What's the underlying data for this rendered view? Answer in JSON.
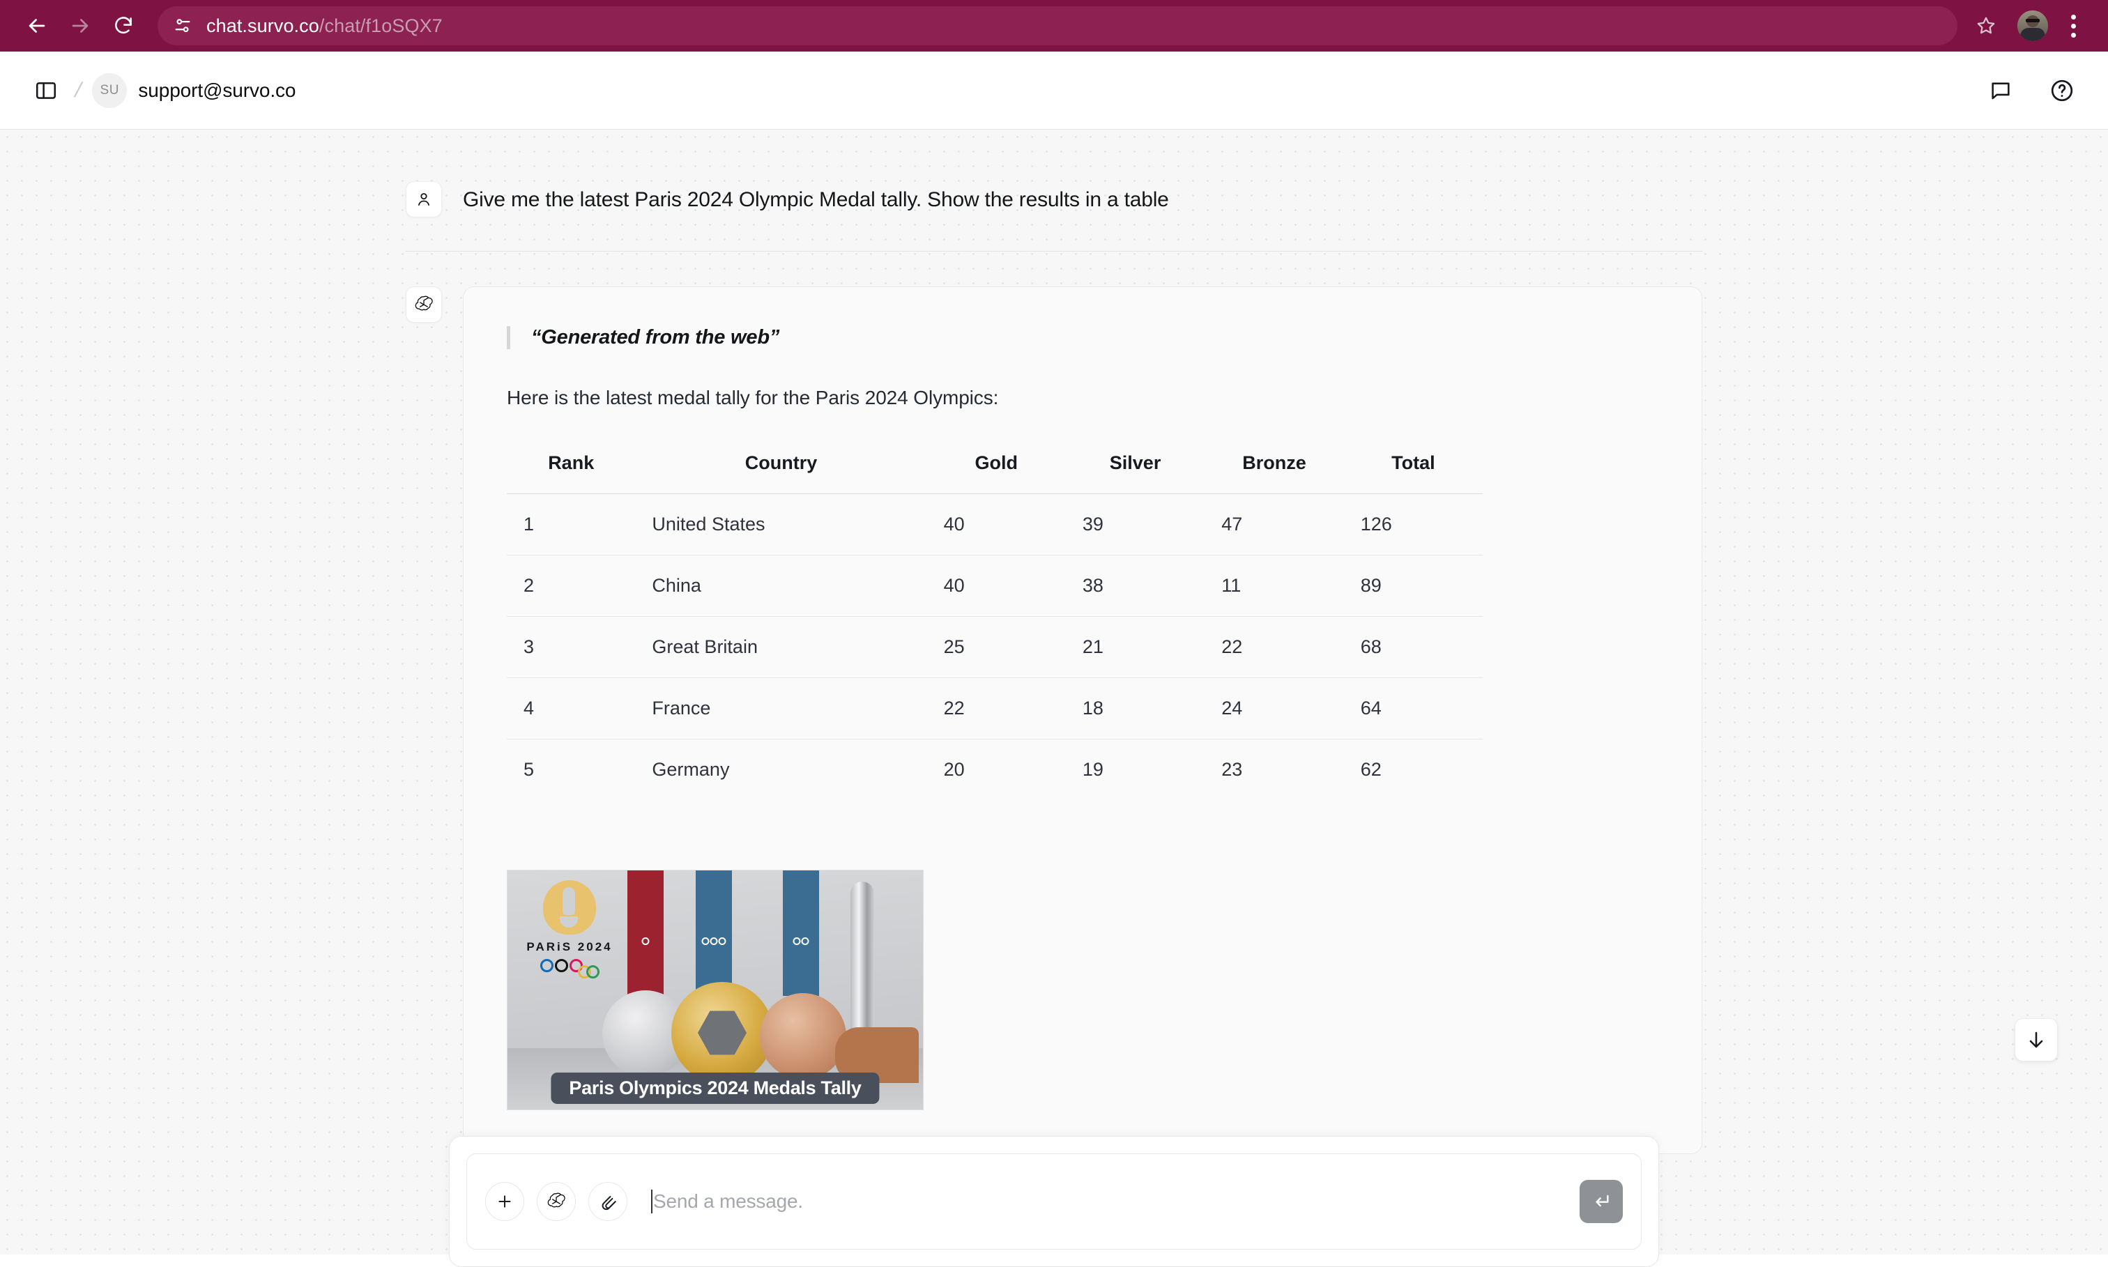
{
  "browser": {
    "back_label": "Back",
    "forward_label": "Forward",
    "reload_label": "Reload",
    "site_info_label": "View site information",
    "url_domain": "chat.survo.co",
    "url_path": "/chat/f1oSQX7",
    "bookmark_label": "Bookmark this tab",
    "profile_label": "Profile",
    "menu_label": "Customize and control",
    "bar_color": "#7d1243",
    "pill_color": "#8d2151"
  },
  "header": {
    "sidebar_toggle_label": "Toggle sidebar",
    "breadcrumb_separator": "/",
    "workspace_initials": "SU",
    "workspace_name": "support@survo.co",
    "feedback_label": "Feedback",
    "help_label": "Help"
  },
  "conversation": {
    "user": {
      "role": "user",
      "message": "Give me the latest Paris 2024 Olympic Medal tally. Show the results in a table"
    },
    "assistant": {
      "role": "assistant",
      "blockquote": "“Generated from the web”",
      "intro": "Here is the latest medal tally for the Paris 2024 Olympics:",
      "image": {
        "brand": "PARiS 2024",
        "caption": "Paris Olympics 2024 Medals Tally",
        "alt": "Paris 2024 Olympic silver, gold and bronze medals with ribbons and the Olympic torch"
      }
    }
  },
  "chart_data": {
    "type": "table",
    "title": "Paris 2024 Olympics Medal Tally",
    "columns": [
      "Rank",
      "Country",
      "Gold",
      "Silver",
      "Bronze",
      "Total"
    ],
    "rows": [
      [
        "1",
        "United States",
        "40",
        "39",
        "47",
        "126"
      ],
      [
        "2",
        "China",
        "40",
        "38",
        "11",
        "89"
      ],
      [
        "3",
        "Great Britain",
        "25",
        "21",
        "22",
        "68"
      ],
      [
        "4",
        "France",
        "22",
        "18",
        "24",
        "64"
      ],
      [
        "5",
        "Germany",
        "20",
        "19",
        "23",
        "62"
      ]
    ]
  },
  "composer": {
    "add_label": "Add",
    "model_label": "Model",
    "attach_label": "Attach file",
    "placeholder": "Send a message.",
    "input_value": "",
    "send_label": "Send"
  },
  "scroll_button": {
    "label": "Scroll to bottom"
  }
}
